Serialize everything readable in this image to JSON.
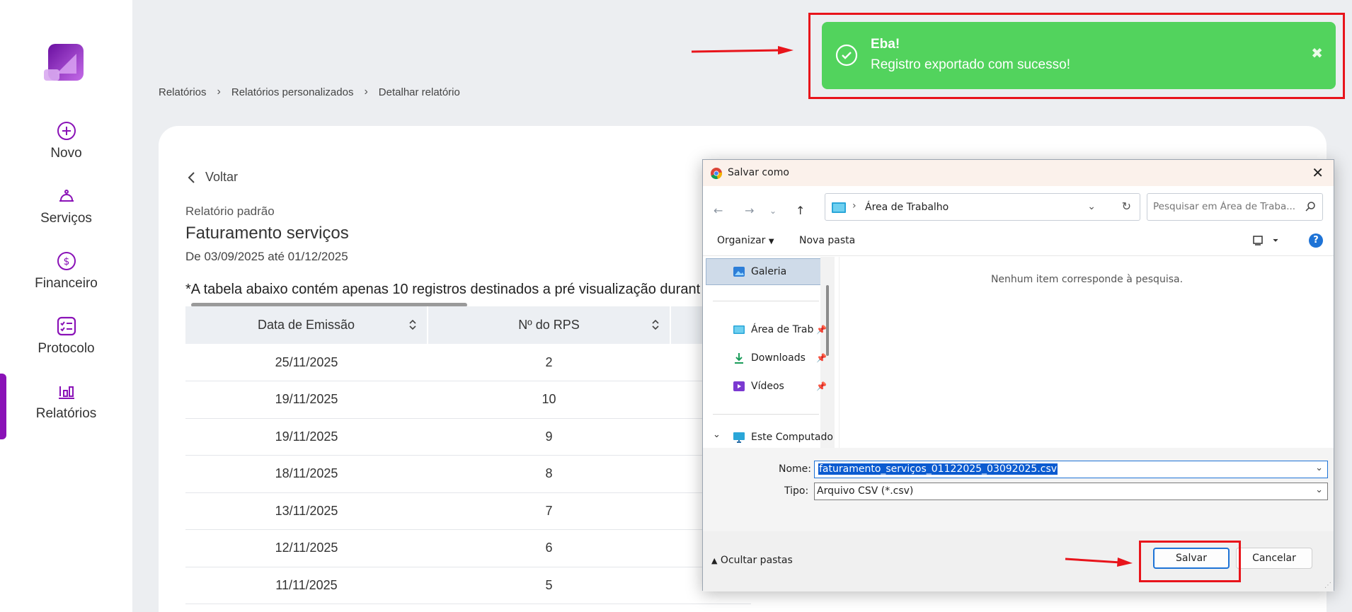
{
  "nav": {
    "items": [
      {
        "label": "Novo",
        "icon": "plus-circle-icon"
      },
      {
        "label": "Serviços",
        "icon": "service-bell-icon"
      },
      {
        "label": "Financeiro",
        "icon": "dollar-circle-icon"
      },
      {
        "label": "Protocolo",
        "icon": "checklist-icon"
      },
      {
        "label": "Relatórios",
        "icon": "bar-chart-icon"
      }
    ],
    "active": "Relatórios"
  },
  "breadcrumb": [
    "Relatórios",
    "Relatórios personalizados",
    "Detalhar relatório"
  ],
  "report": {
    "back_label": "Voltar",
    "subtitle": "Relatório padrão",
    "title": "Faturamento serviços",
    "range": "De 03/09/2025 até 01/12/2025",
    "notice": "*A tabela abaixo contém apenas 10 registros destinados a pré visualização durant",
    "columns": [
      "Data de Emissão",
      "Nº do RPS"
    ],
    "rows": [
      [
        "25/11/2025",
        "2"
      ],
      [
        "19/11/2025",
        "10"
      ],
      [
        "19/11/2025",
        "9"
      ],
      [
        "18/11/2025",
        "8"
      ],
      [
        "13/11/2025",
        "7"
      ],
      [
        "12/11/2025",
        "6"
      ],
      [
        "11/11/2025",
        "5"
      ]
    ]
  },
  "toast": {
    "title": "Eba!",
    "message": "Registro exportado com sucesso!",
    "close": "✖",
    "color": "#52d35d"
  },
  "dialog": {
    "title": "Salvar como",
    "address": "Área de Trabalho",
    "search_placeholder": "Pesquisar em Área de Traba...",
    "organize": "Organizar",
    "new_folder": "Nova pasta",
    "nav_items": [
      "Galeria",
      "Área de Trab",
      "Downloads",
      "Vídeos",
      "Este Computado"
    ],
    "empty_message": "Nenhum item corresponde à pesquisa.",
    "name_label": "Nome:",
    "name_value": "faturamento_serviços_01122025_03092025.csv",
    "type_label": "Tipo:",
    "type_value": "Arquivo CSV (*.csv)",
    "hide_folders": "Ocultar pastas",
    "save_label": "Salvar",
    "cancel_label": "Cancelar"
  },
  "colors": {
    "brand": "#8a12b7",
    "highlight": "#e8141b"
  }
}
